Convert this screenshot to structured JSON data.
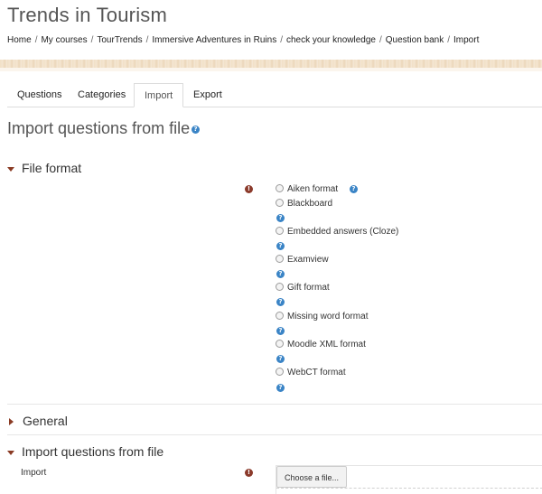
{
  "site": {
    "title": "Trends in Tourism"
  },
  "breadcrumb": [
    {
      "label": "Home"
    },
    {
      "label": "My courses"
    },
    {
      "label": "TourTrends"
    },
    {
      "label": "Immersive Adventures in Ruins"
    },
    {
      "label": "check your knowledge"
    },
    {
      "label": "Question bank"
    },
    {
      "label": "Import"
    }
  ],
  "breadcrumb_separator": "/",
  "tabs": [
    {
      "label": "Questions"
    },
    {
      "label": "Categories"
    },
    {
      "label": "Import",
      "active": true
    },
    {
      "label": "Export"
    }
  ],
  "page": {
    "heading": "Import questions from file"
  },
  "sections": {
    "file_format": {
      "label": "File format",
      "expanded": true
    },
    "general": {
      "label": "General",
      "expanded": false
    },
    "import": {
      "label": "Import questions from file",
      "expanded": true
    }
  },
  "file_formats": [
    {
      "label": "Aiken format"
    },
    {
      "label": "Blackboard"
    },
    {
      "label": "Embedded answers (Cloze)"
    },
    {
      "label": "Examview"
    },
    {
      "label": "Gift format"
    },
    {
      "label": "Missing word format"
    },
    {
      "label": "Moodle XML format"
    },
    {
      "label": "WebCT format"
    }
  ],
  "import_field": {
    "label": "Import",
    "button": "Choose a file..."
  },
  "icons": {
    "help": "?",
    "required": "!"
  },
  "colors": {
    "help_icon": "#3a84c6",
    "required_icon": "#8b3a2b",
    "caret": "#8a3b24"
  }
}
